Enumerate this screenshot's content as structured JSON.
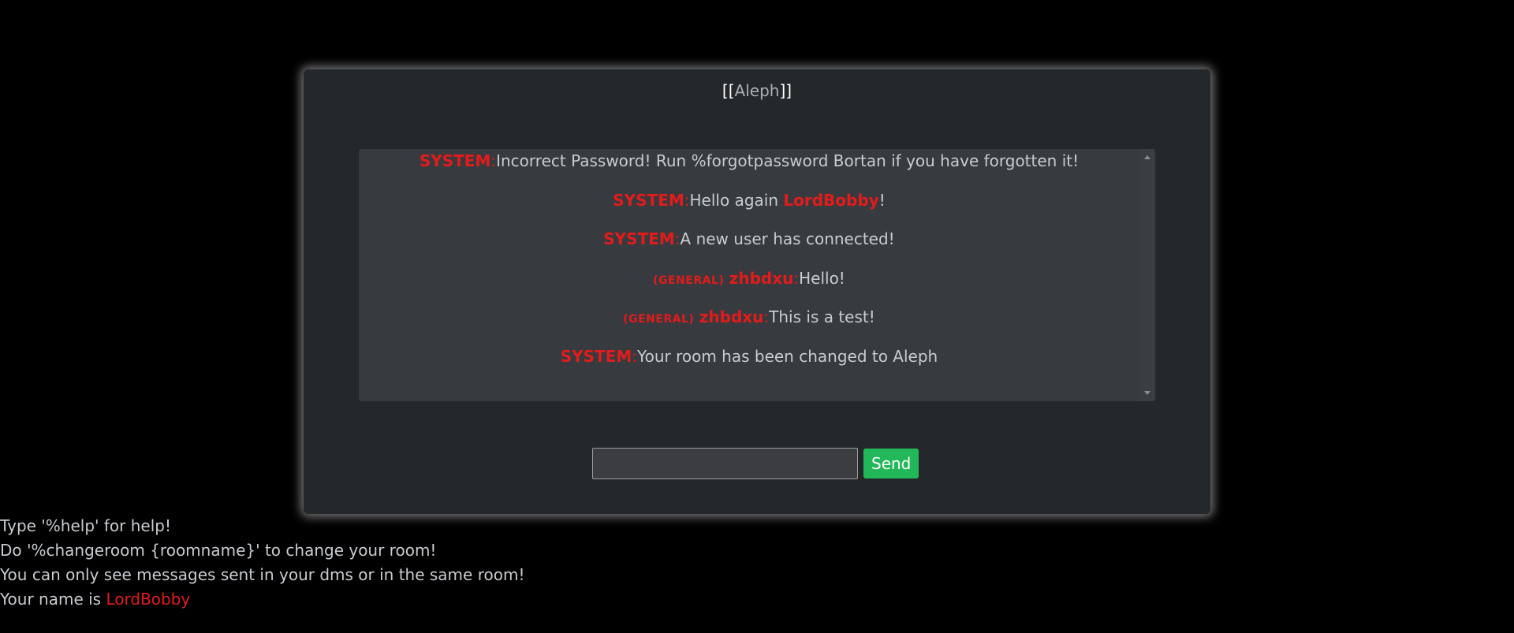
{
  "room": {
    "open_brackets": "[[",
    "name": "Aleph",
    "close_brackets": "]]"
  },
  "messages": [
    {
      "sender": "SYSTEM",
      "colon": ":",
      "text": "Incorrect Password! Run %forgotpassword Bortan if you have forgotten it!"
    },
    {
      "sender": "SYSTEM",
      "colon": ":",
      "text_before": "Hello again ",
      "mention": "LordBobby",
      "text_after": "!"
    },
    {
      "sender": "SYSTEM",
      "colon": ":",
      "text": "A new user has connected!"
    },
    {
      "room_tag": "(GENERAL)",
      "sender": "zhbdxu",
      "colon": ":",
      "text": "Hello!"
    },
    {
      "room_tag": "(GENERAL)",
      "sender": "zhbdxu",
      "colon": ":",
      "text": "This is a test!"
    },
    {
      "sender": "SYSTEM",
      "colon": ":",
      "text": "Your room has been changed to Aleph"
    }
  ],
  "composer": {
    "input_value": "",
    "send_label": "Send"
  },
  "help": {
    "line1": "Type '%help' for help!",
    "line2": "Do '%changeroom {roomname}' to change your room!",
    "line3": "You can only see messages sent in your dms or in the same room!",
    "line4_prefix": "Your name is ",
    "user_name": "LordBobby"
  },
  "colors": {
    "background": "#000000",
    "panel": "#25282b",
    "message_box": "#373a3e",
    "accent_red": "#e31b1b",
    "send_green": "#22b85a",
    "text": "#c8ccd0"
  },
  "icons": {
    "scroll_up": "scroll-up-arrow-icon",
    "scroll_down": "scroll-down-arrow-icon"
  }
}
